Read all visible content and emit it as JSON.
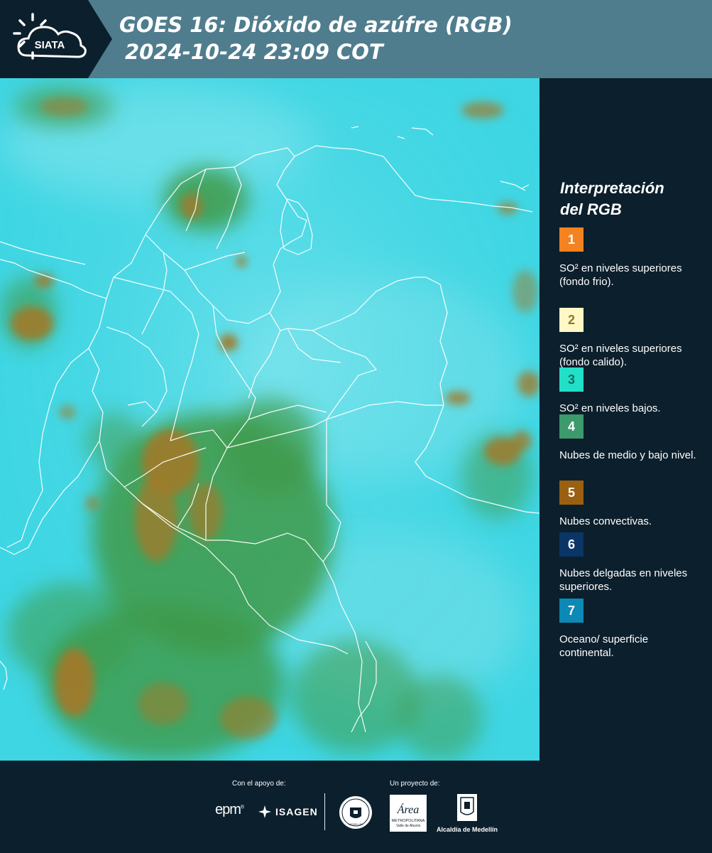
{
  "header": {
    "logo_text": "SIATA",
    "title_line_1": "GOES 16: Dióxido de azúfre (RGB)",
    "title_line_2": "2024-10-24 23:09 COT"
  },
  "legend": {
    "title_line_1": "Interpretación",
    "title_line_2": "del RGB",
    "items": [
      {
        "number": "1",
        "color": "#f58220",
        "text_color": "#ffffff",
        "description": "SO² en niveles superiores (fondo frio)."
      },
      {
        "number": "2",
        "color": "#fff8c4",
        "text_color": "#8a7a30",
        "description": "SO² en niveles superiores (fondo calido)."
      },
      {
        "number": "3",
        "color": "#22e0c8",
        "text_color": "#0e6a66",
        "description": "SO² en niveles bajos."
      },
      {
        "number": "4",
        "color": "#3d9a6c",
        "text_color": "#ffffff",
        "description": "Nubes de medio y bajo nivel."
      },
      {
        "number": "5",
        "color": "#9a6010",
        "text_color": "#ffffff",
        "description": "Nubes convectivas."
      },
      {
        "number": "6",
        "color": "#0b3566",
        "text_color": "#ffffff",
        "description": "Nubes delgadas en niveles superiores."
      },
      {
        "number": "7",
        "color": "#0c89b5",
        "text_color": "#ffffff",
        "description": "Oceano/ superficie continental."
      }
    ]
  },
  "footer": {
    "support_label": "Con el apoyo de:",
    "project_label": "Un proyecto de:",
    "epm_text": "epm",
    "isagen_text": "ISAGEN",
    "area_text_1": "Área",
    "area_text_2": "METROPOLITANA",
    "area_text_3": "Valle de Aburrá",
    "alcaldia_text": "Alcaldía de Medellín",
    "seal_text": "MEDELLÍN"
  },
  "colors": {
    "background": "#0c1f2c",
    "header_band": "#4f7d8e",
    "ocean_cyan": "#3fd6e4",
    "cloud_green": "#3f9a48",
    "convective_brown": "#a07a2a"
  }
}
